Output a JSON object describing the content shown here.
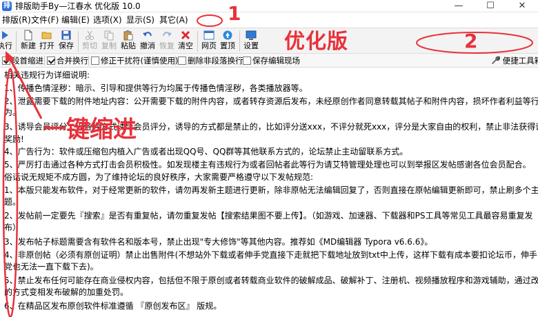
{
  "window": {
    "title": "排版助手By—江春水 优化版 10.0",
    "minimize_glyph": "—",
    "maximize_glyph": "☐",
    "close_glyph": "✕"
  },
  "menu": [
    {
      "label": "排版(R)"
    },
    {
      "label": "文件(F)"
    },
    {
      "label": "编辑(E)"
    },
    {
      "label": "选项(X)"
    },
    {
      "label": "显示(S)"
    },
    {
      "label": "其它(A)"
    }
  ],
  "toolbar": {
    "items": [
      {
        "label": "执行",
        "icon": "play-icon",
        "disabled": false
      },
      {
        "label": "新建",
        "icon": "new-file-icon",
        "disabled": false
      },
      {
        "label": "打开",
        "icon": "open-folder-icon",
        "disabled": false
      },
      {
        "label": "保存",
        "icon": "save-icon",
        "disabled": false
      },
      {
        "label": "剪切",
        "icon": "cut-icon",
        "disabled": true
      },
      {
        "label": "复制",
        "icon": "copy-icon",
        "disabled": true
      },
      {
        "label": "粘贴",
        "icon": "paste-icon",
        "disabled": false
      },
      {
        "label": "撤消",
        "icon": "undo-icon",
        "disabled": false
      },
      {
        "label": "恢复",
        "icon": "redo-icon",
        "disabled": true
      },
      {
        "label": "清空",
        "icon": "clear-icon",
        "disabled": false
      },
      {
        "label": "网页",
        "icon": "web-icon",
        "disabled": false
      },
      {
        "label": "置顶",
        "icon": "pin-top-icon",
        "disabled": false
      },
      {
        "label": "设置",
        "icon": "settings-icon",
        "disabled": false
      }
    ]
  },
  "options": {
    "items": [
      {
        "label": "段首缩进",
        "checked": true
      },
      {
        "label": "合并换行",
        "checked": true
      },
      {
        "label": "修正干扰符(谨慎使用)",
        "checked": false
      },
      {
        "label": "删除非段落换行",
        "checked": false
      },
      {
        "label": "保存编辑现场",
        "checked": false
      }
    ],
    "right_tool": "便捷工具箱"
  },
  "editor": {
    "lines": [
      "    相关违规行为详细说明:",
      "1、传播色情淫秽：暗示、引导和提供等行为均属于传播色情淫秽，各类播放器等。",
      "2、泄露需要下载的附件地址内容：公开需要下载的附件内容，或者转存资源后发布，未经原创作者同意转载其帖子和附件内容，损坏作者利益等行",
      "为。",
      "3、诱导会员评分：以各种方式诱导会员评分，诱导的方式都是禁止的，比如评分送xxx，不评分就死xxx，评分是大家自由的权利，禁止非法获得评分，禁止添加回",
      "奖励!",
      "4、广告行为：软件或压缩包内植入广告或者出现QQ号、QQ群等其他联系方式的，论坛禁止主动留联系方式。",
      "5、严厉打击通过各种方式打击会员积极性。如发现楼主有违规行为或者回帖者此等行为请艾特管理处理也可以到举报区发帖感谢各位会员配合。",
      "    俗话说无规矩不成方圆，为了维持论坛的良好秩序，大家需要严格遵守以下发帖规范:",
      "1、本版只能发布软件，对于经常更新的软件，请勿再发新主题进行更新，除非原帖无法编辑回复了，否则直接在原帖编辑更新即可，禁止刷多个主",
      "题。",
      "2、发帖前一定要先『搜索』是否有重复帖，请勿重复发帖【搜索结果图不要上传】。（如游戏、加速器、下载器和PS工具等常见工具最容易重复发",
      "布）",
      "3、发布帖子标题需要含有软件名和版本号，禁止出现\"专大修饰\"等其他内容。推荐如《MD编辑器 Typora v6.6.6》。",
      "4、非原创帖（必须有原创证明）禁止出售附件(不想站外下载或者伸手党直接下走就把下载地址放到txt中上传，这样下载有成本要扣论坛币，伸手",
      "党也无法一直下载下去)。",
      "5、禁止发布任何可能存在商业侵权内容，包括但不限于原创或者转载商业软件的破解成品、破解补丁、注册机、视频播放程序和游戏辅助，通过改称",
      "的方式变相发布破解的加重处罚。",
      "6、在精品区发布原创软件标准遵循 『原创发布区』 版规。"
    ]
  },
  "annotations": {
    "label_one": "1",
    "label_two": "2",
    "optimized_label": "优化版",
    "indent_label": "一键缩进"
  }
}
